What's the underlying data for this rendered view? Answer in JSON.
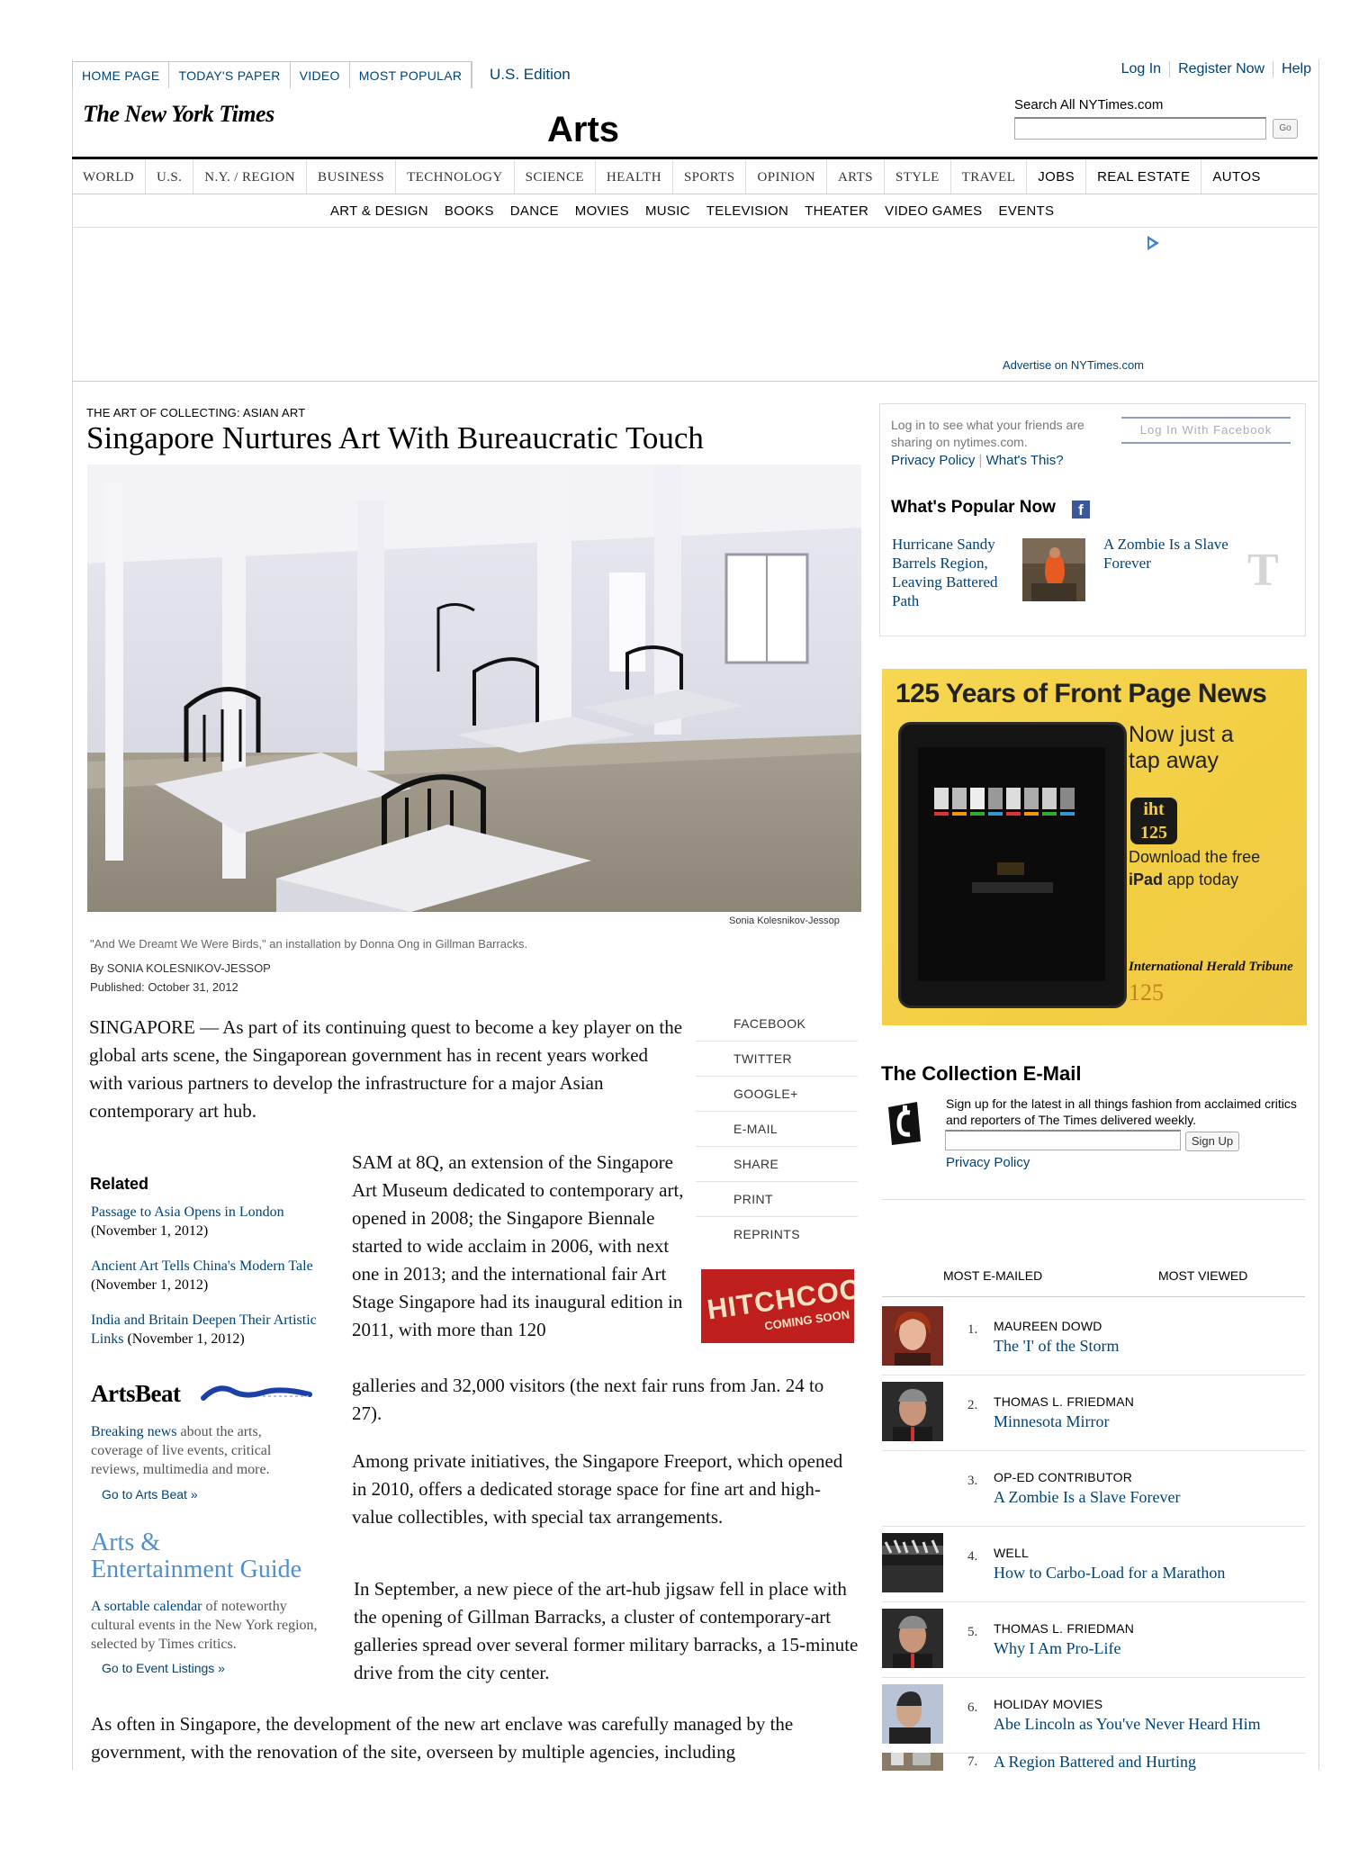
{
  "top_tabs": [
    "HOME PAGE",
    "TODAY'S PAPER",
    "VIDEO",
    "MOST POPULAR"
  ],
  "edition": "U.S. Edition",
  "user_links": [
    "Log In",
    "Register Now",
    "Help"
  ],
  "logo": "The New York Times",
  "section_title": "Arts",
  "search": {
    "label": "Search All NYTimes.com",
    "button": "Go"
  },
  "main_nav": [
    "WORLD",
    "U.S.",
    "N.Y. / REGION",
    "BUSINESS",
    "TECHNOLOGY",
    "SCIENCE",
    "HEALTH",
    "SPORTS",
    "OPINION",
    "ARTS",
    "STYLE",
    "TRAVEL"
  ],
  "main_nav_bold": [
    "JOBS",
    "REAL ESTATE",
    "AUTOS"
  ],
  "sub_nav": [
    "ART & DESIGN",
    "BOOKS",
    "DANCE",
    "MOVIES",
    "MUSIC",
    "TELEVISION",
    "THEATER",
    "VIDEO GAMES",
    "EVENTS"
  ],
  "ad": {
    "advertise": "Advertise on NYTimes.com"
  },
  "article": {
    "kicker": "THE ART OF COLLECTING: ASIAN ART",
    "headline": "Singapore Nurtures Art With Bureaucratic Touch",
    "photo_credit": "Sonia Kolesnikov-Jessop",
    "caption": "\"And We Dreamt We Were Birds,\" an installation by Donna Ong in Gillman Barracks.",
    "byline": "By SONIA KOLESNIKOV-JESSOP",
    "published": "Published: October 31, 2012",
    "p1": "SINGAPORE — As part of its continuing quest to become a key player on the global arts scene, the Singaporean government has in recent years worked with various partners to develop the infrastructure for a major Asian contemporary art hub.",
    "p2": "SAM at 8Q, an extension of the Singapore Art Museum dedicated to contemporary art, opened in 2008; the Singapore Biennale started to wide acclaim in 2006, with next one in 2013; and the international fair Art Stage Singapore had its inaugural edition in 2011, with more than 120",
    "p2b": "galleries and 32,000 visitors (the next fair runs from Jan. 24 to 27).",
    "p3": "Among private initiatives, the Singapore Freeport, which opened in 2010, offers a dedicated storage space for fine art and high-value collectibles, with special tax arrangements.",
    "p4": "In September, a new piece of the art-hub jigsaw fell in place with the opening of Gillman Barracks, a cluster of contemporary-art galleries spread over several former military barracks, a 15-minute drive from the city center.",
    "p5": "As often in Singapore, the development of the new art enclave was carefully managed by the government, with the renovation of the site, overseen by multiple agencies, including"
  },
  "share": [
    "FACEBOOK",
    "TWITTER",
    "GOOGLE+",
    "E-MAIL",
    "SHARE",
    "PRINT",
    "REPRINTS"
  ],
  "hitchcock_ad": {
    "title": "HITCHCOCK",
    "subtitle": "COMING SOON"
  },
  "related": {
    "heading": "Related",
    "items": [
      {
        "link": "Passage to Asia Opens in London",
        "date": "(November 1, 2012)"
      },
      {
        "link": "Ancient Art Tells China's Modern Tale",
        "date": "(November 1, 2012)"
      },
      {
        "link": "India and Britain Deepen Their Artistic Links",
        "date": "(November 1, 2012)"
      }
    ]
  },
  "arts_beat": {
    "title": "ArtsBeat",
    "link": "Breaking news",
    "desc": "about the arts, coverage of live events, critical reviews, multimedia and more.",
    "go": "Go to Arts Beat »"
  },
  "guide": {
    "title_line1": "Arts &",
    "title_line2": "Entertainment Guide",
    "link": "A sortable calendar",
    "desc": "of noteworthy cultural events in the New York region, selected by Times critics.",
    "go": "Go to Event Listings »"
  },
  "facebook": {
    "text": "Log in to see what your friends are sharing on nytimes.com.",
    "privacy": "Privacy Policy",
    "whats_this": "What's This?",
    "button": "Log In With Facebook"
  },
  "popular": {
    "heading": "What's Popular Now",
    "item1": "Hurricane Sandy Barrels Region, Leaving Battered Path",
    "item2": "A Zombie Is a Slave Forever",
    "tlogo": "T"
  },
  "iht_ad": {
    "title": "125 Years of Front Page News",
    "line1": "Now just a tap away",
    "badge_top": "iht",
    "badge_num": "125",
    "line2": "Download the free",
    "line3_bold": "iPad",
    "line3": "app today",
    "name": "International Herald Tribune",
    "years": "125"
  },
  "collection": {
    "heading": "The Collection E-Mail",
    "text": "Sign up for the latest in all things fashion from acclaimed critics and reporters of The Times delivered weekly.",
    "button": "Sign Up",
    "privacy": "Privacy Policy"
  },
  "most": {
    "tab1": "MOST E-MAILED",
    "tab2": "MOST VIEWED",
    "items": [
      {
        "num": "1.",
        "by": "MAUREEN DOWD",
        "title": "The 'I' of the Storm"
      },
      {
        "num": "2.",
        "by": "THOMAS L. FRIEDMAN",
        "title": "Minnesota Mirror"
      },
      {
        "num": "3.",
        "by": "OP-ED CONTRIBUTOR",
        "title": "A Zombie Is a Slave Forever"
      },
      {
        "num": "4.",
        "by": "WELL",
        "title": "How to Carbo-Load for a Marathon"
      },
      {
        "num": "5.",
        "by": "THOMAS L. FRIEDMAN",
        "title": "Why I Am Pro-Life"
      },
      {
        "num": "6.",
        "by": "HOLIDAY MOVIES",
        "title": "Abe Lincoln as You've Never Heard Him"
      },
      {
        "num": "7.",
        "by": "",
        "title": "A Region Battered and Hurting"
      }
    ]
  }
}
